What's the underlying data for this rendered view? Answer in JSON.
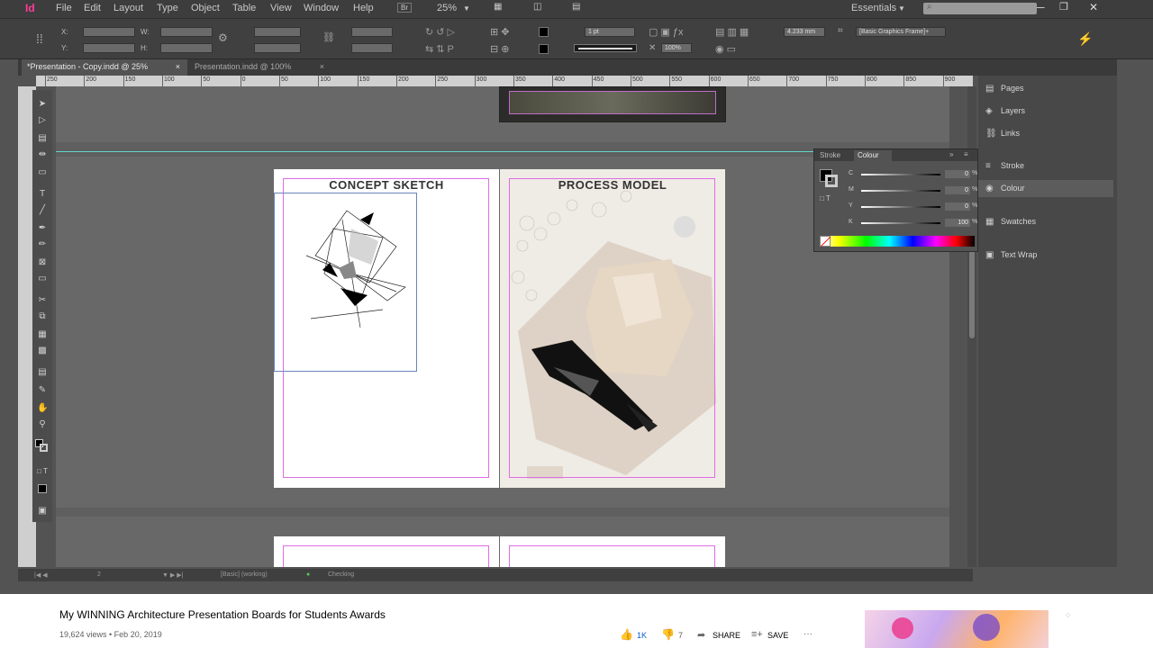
{
  "menu": {
    "logo": "Id",
    "items": [
      "File",
      "Edit",
      "Layout",
      "Type",
      "Object",
      "Table",
      "View",
      "Window",
      "Help"
    ],
    "bridge": "Br",
    "zoom": "25%",
    "workspace": "Essentials"
  },
  "control": {
    "stroke_weight": "1 pt",
    "opacity": "100%",
    "measure": "4.233 mm",
    "object_style": "[Basic Graphics Frame]+",
    "x_label": "X:",
    "y_label": "Y:",
    "w_label": "W:",
    "h_label": "H:"
  },
  "tabs": [
    {
      "label": "*Presentation - Copy.indd @ 25%"
    },
    {
      "label": "Presentation.indd @ 100%"
    }
  ],
  "ruler": {
    "ticks": [
      "250",
      "200",
      "150",
      "100",
      "50",
      "0",
      "50",
      "100",
      "150",
      "200",
      "250",
      "300",
      "350",
      "400",
      "450",
      "500",
      "550",
      "600",
      "650",
      "700",
      "750",
      "800",
      "850",
      "900"
    ]
  },
  "pages": {
    "left_title": "CONCEPT SKETCH",
    "right_title": "PROCESS MODEL"
  },
  "panels": {
    "dock": [
      "Pages",
      "Layers",
      "Links",
      "Stroke",
      "Colour",
      "Swatches",
      "Text Wrap"
    ],
    "colour_tabs": [
      "Stroke",
      "Colour"
    ],
    "cmyk": [
      {
        "label": "C",
        "value": "0"
      },
      {
        "label": "M",
        "value": "0"
      },
      {
        "label": "Y",
        "value": "0"
      },
      {
        "label": "K",
        "value": "100"
      }
    ],
    "pct": "%"
  },
  "status": {
    "page": "2",
    "preflight_profile": "[Basic] (working)",
    "preflight_state": "Checking"
  },
  "video": {
    "title": "My WINNING Architecture Presentation Boards for Students Awards",
    "meta": "19,624 views • Feb 20, 2019",
    "likes": "1K",
    "dislikes": "7",
    "share": "SHARE",
    "save": "SAVE",
    "more": "···"
  },
  "colors": {
    "accent": "#ff3c9a",
    "margin_guide": "#e06ce6",
    "like_blue": "#065fd4"
  }
}
